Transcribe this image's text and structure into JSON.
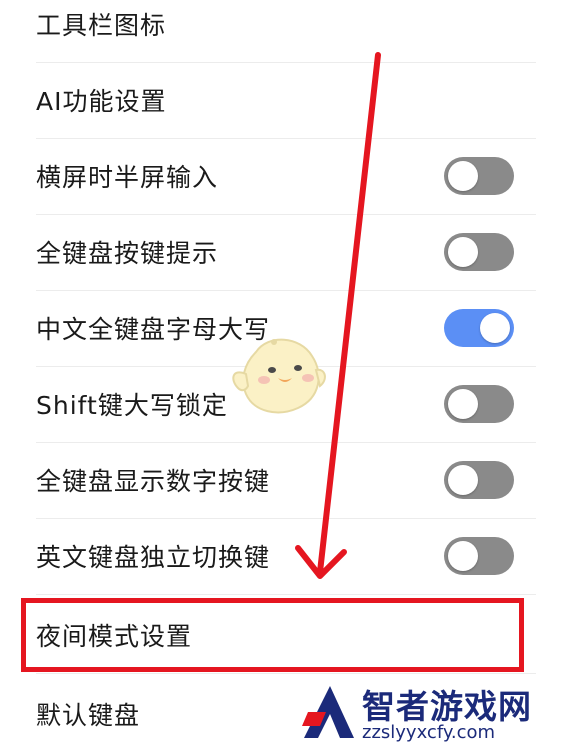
{
  "settings": {
    "items": [
      {
        "label": "工具栏图标"
      },
      {
        "label": "AI功能设置"
      },
      {
        "label": "横屏时半屏输入",
        "toggle": "off"
      },
      {
        "label": "全键盘按键提示",
        "toggle": "off"
      },
      {
        "label": "中文全键盘字母大写",
        "toggle": "on"
      },
      {
        "label": "Shift键大写锁定",
        "toggle": "off"
      },
      {
        "label": "全键盘显示数字按键",
        "toggle": "off"
      },
      {
        "label": "英文键盘独立切换键",
        "toggle": "off"
      },
      {
        "label": "夜间模式设置"
      },
      {
        "label": "默认键盘"
      }
    ]
  },
  "watermark": {
    "title": "智者游戏网",
    "url": "zzslyyxcfy.com"
  },
  "colors": {
    "toggle_on": "#5b8ff5",
    "toggle_off": "#8a8a8a",
    "annotation_red": "#e51620"
  }
}
